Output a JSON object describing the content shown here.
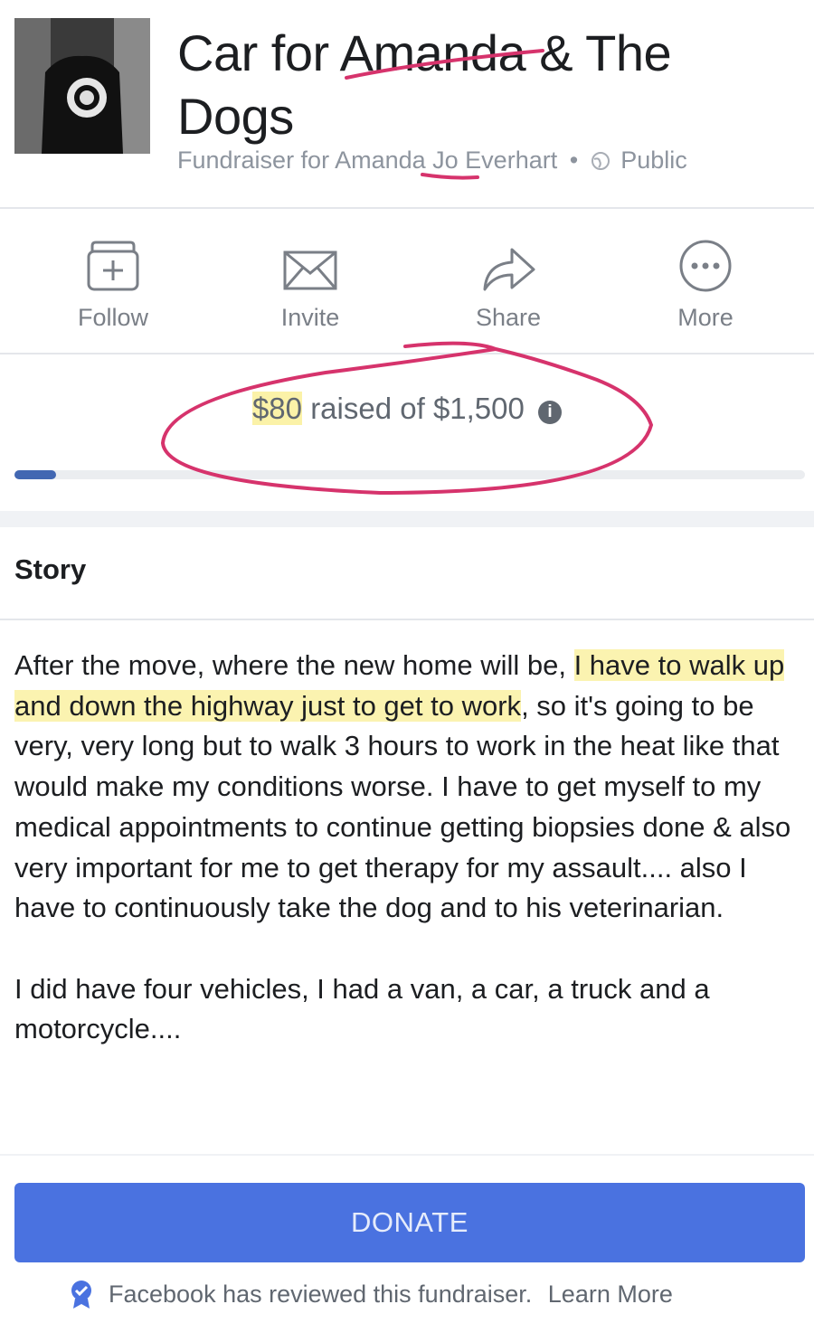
{
  "header": {
    "title": "Car for Amanda & The Dogs",
    "subtitle_prefix": "Fundraiser for",
    "organizer": "Amanda Jo Everhart",
    "separator": "•",
    "privacy": "Public"
  },
  "actions": [
    {
      "label": "Follow",
      "icon": "follow-plus-icon"
    },
    {
      "label": "Invite",
      "icon": "envelope-icon"
    },
    {
      "label": "Share",
      "icon": "share-arrow-icon"
    },
    {
      "label": "More",
      "icon": "more-dots-icon"
    }
  ],
  "progress": {
    "raised": "$80",
    "raised_text": "raised of",
    "goal": "$1,500",
    "fraction": 0.053
  },
  "story": {
    "heading": "Story",
    "paragraph1_start": "After the move, where the new home will be, ",
    "paragraph1_highlight": "I have to walk up and down the highway just to get to work",
    "paragraph1_end": ", so it's going to be very, very long but to walk 3 hours to work in the heat like that would make my conditions worse. I have to get myself to my medical appointments to continue getting biopsies done & also very important for me to get therapy for my assault.... also I have to continuously take the dog and to his veterinarian.",
    "paragraph2": "I did have four vehicles, I had a van, a car, a truck and a motorcycle...."
  },
  "donate_label": "DONATE",
  "footer": {
    "reviewed_text": "Facebook has reviewed this fundraiser.",
    "learn_more": "Learn More"
  },
  "colors": {
    "primary_button": "#4a72e0",
    "progress_fill": "#4267b2",
    "annotation_ink": "#d6336c",
    "highlighter": "#fbf3b0"
  }
}
